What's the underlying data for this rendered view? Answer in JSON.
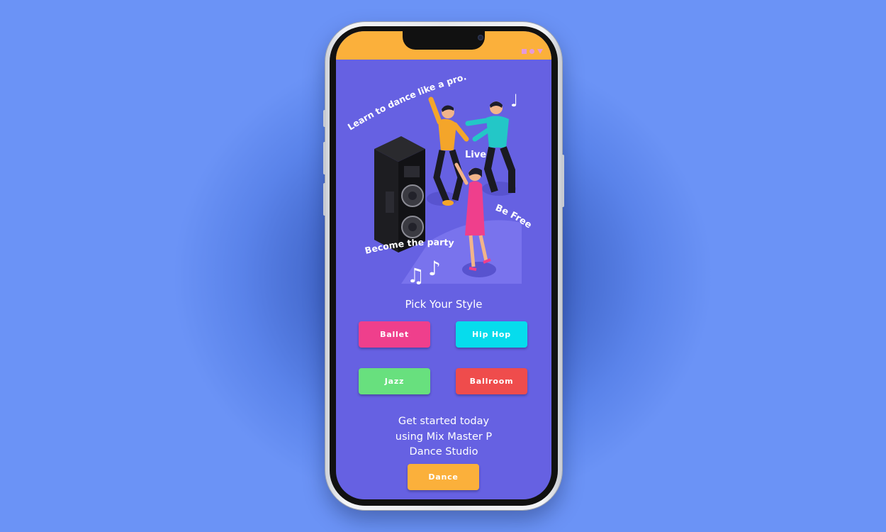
{
  "theme": {
    "background": "#6b93f6",
    "screen_bg": "#6661e2",
    "status_bar": "#fbb03b",
    "status_icons": "#e59ad9"
  },
  "hero": {
    "caption_top": "Learn to dance like a pro.",
    "caption_live": "Live",
    "caption_free": "Be Free",
    "caption_party": "Become the party",
    "icons": [
      "speaker-icon",
      "music-note-icon",
      "dancers-illustration"
    ]
  },
  "section_title": "Pick Your Style",
  "styles": [
    {
      "label": "Ballet",
      "color": "#ef3f8c"
    },
    {
      "label": "Hip Hop",
      "color": "#06dced"
    },
    {
      "label": "Jazz",
      "color": "#68e07e"
    },
    {
      "label": "Ballroom",
      "color": "#ef4c4c"
    }
  ],
  "cta": {
    "line1": "Get started today",
    "line2": "using Mix Master P",
    "line3": "Dance Studio"
  },
  "dance_button": {
    "label": "Dance",
    "color": "#fbb03b"
  }
}
